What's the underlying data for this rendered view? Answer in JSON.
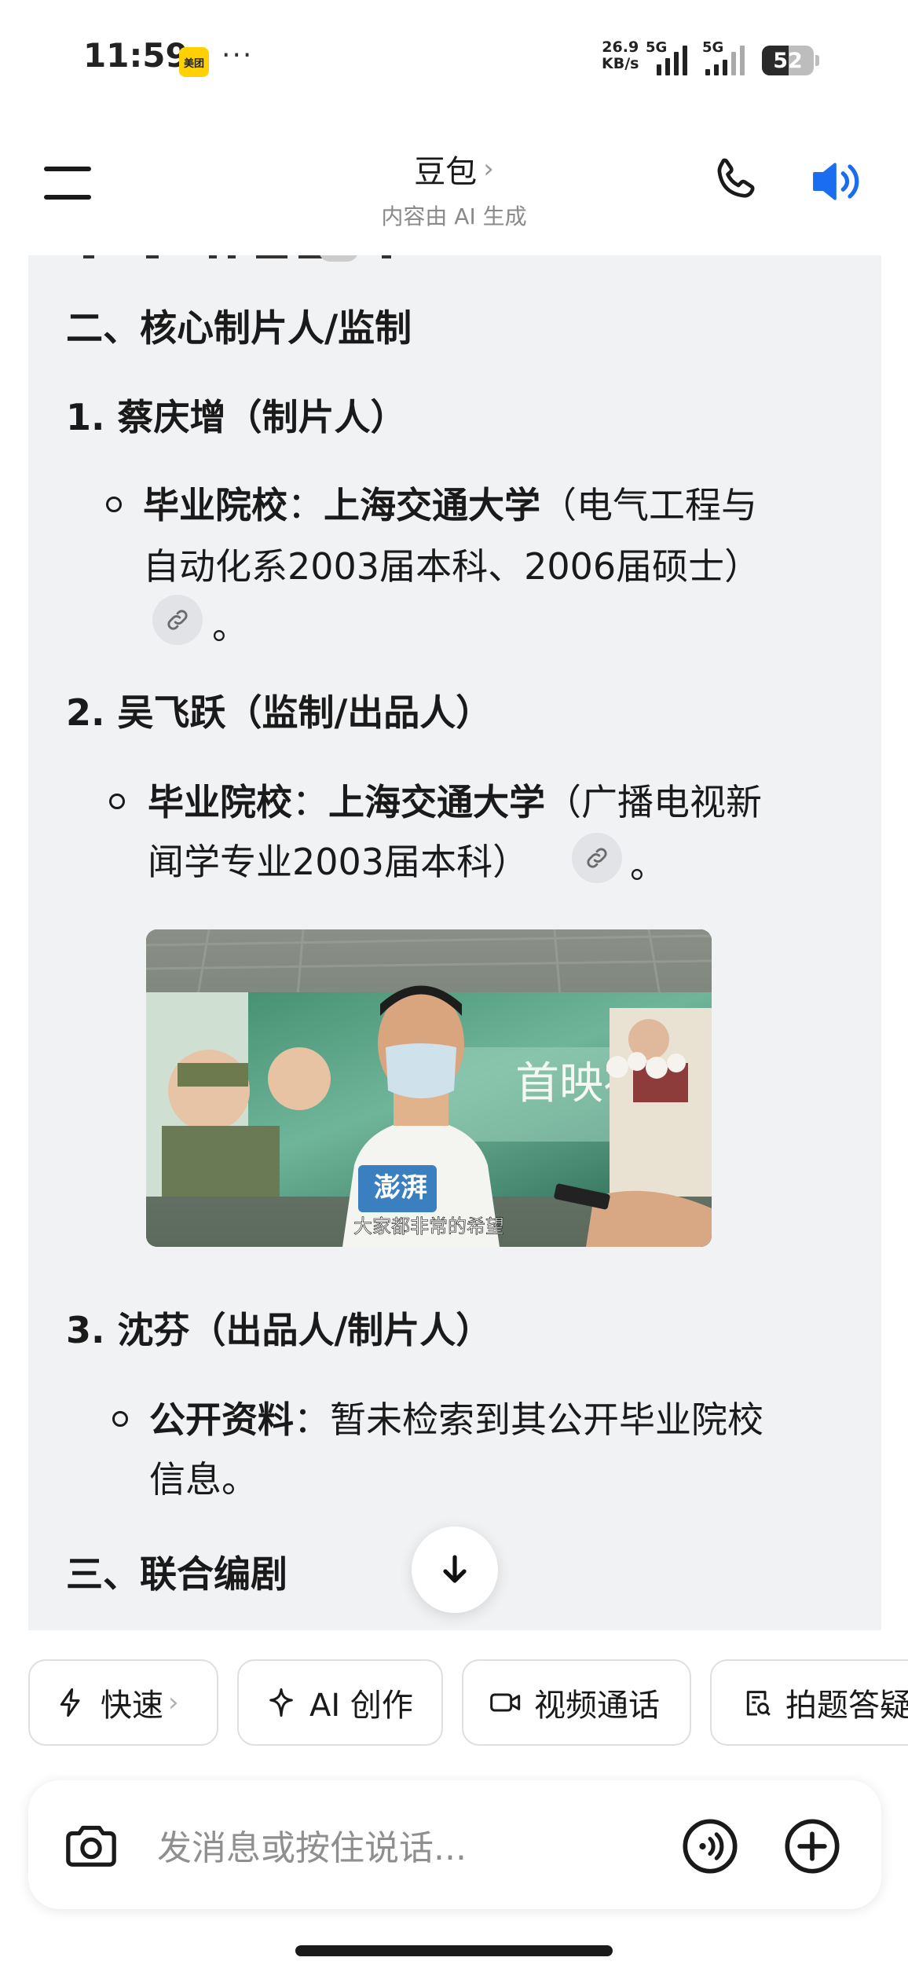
{
  "status_bar": {
    "time": "11:59",
    "app_badge": "美团",
    "more": "···",
    "net_speed_value": "26.9",
    "net_speed_unit": "KB/s",
    "signal1_label": "5G",
    "signal2_label": "5G",
    "battery": "52"
  },
  "header": {
    "title": "豆包",
    "title_chevron": "›",
    "subtitle": "内容由 AI 生成"
  },
  "content": {
    "section2_heading": "二、核心制片人/监制",
    "item1_title": "1. 蔡庆增（制片人）",
    "item1_label": "毕业院校",
    "item1_colon": "：",
    "item1_school": "上海交通大学",
    "item1_detail_line1": "（电气工程与",
    "item1_detail_line2": "自动化系2003届本科、2006届硕士）",
    "item1_end": "。",
    "item2_title": "2. 吴飞跃（监制/出品人）",
    "item2_label": "毕业院校",
    "item2_colon": "：",
    "item2_school": "上海交通大学",
    "item2_detail_line1": "（广播电视新",
    "item2_detail_line2": "闻学专业2003届本科）",
    "item2_end": "。",
    "photo_poster_title": "首映礼",
    "photo_logo": "澎湃",
    "photo_caption": "大家都非常的希望",
    "item3_title": "3. 沈芬（出品人/制片人）",
    "item3_label": "公开资料",
    "item3_colon": "：",
    "item3_detail_line1": "暂未检索到其公开毕业院校",
    "item3_detail_line2": "信息。",
    "section3_heading": "三、联合编剧"
  },
  "chips": [
    {
      "label": "快速",
      "icon": "lightning-icon"
    },
    {
      "label": "AI 创作",
      "icon": "sparkle-icon"
    },
    {
      "label": "视频通话",
      "icon": "video-icon"
    },
    {
      "label": "拍题答疑",
      "icon": "scan-question-icon"
    }
  ],
  "chip_chevron": "›",
  "input": {
    "placeholder": "发消息或按住说话..."
  },
  "colors": {
    "accent_blue": "#1a6cf0",
    "panel_bg": "#f1f2f4",
    "meituan_yellow": "#ffd100"
  }
}
